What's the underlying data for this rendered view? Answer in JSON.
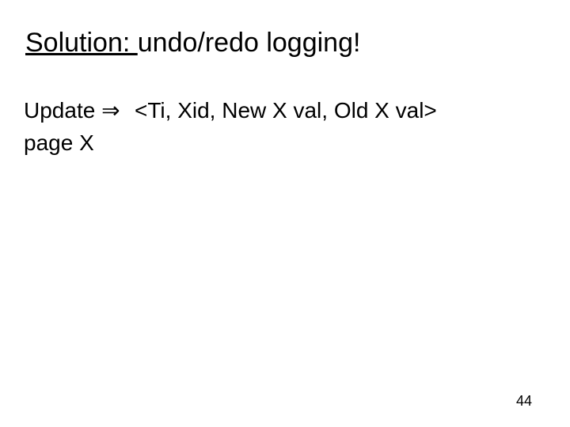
{
  "title": {
    "underlined": "Solution: ",
    "rest": "undo/redo logging!"
  },
  "body": {
    "left_line1": "Update",
    "arrow": "⇒",
    "right_line1": "<Ti, Xid, New X val, Old X val>",
    "left_line2": "page X"
  },
  "page_number": "44"
}
